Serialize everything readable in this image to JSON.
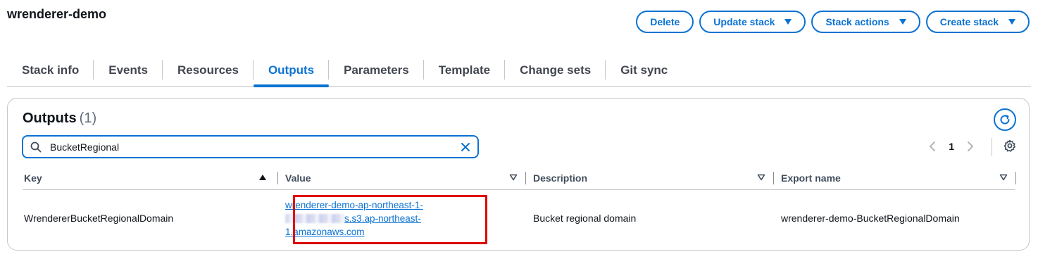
{
  "header": {
    "title": "wrenderer-demo"
  },
  "actions": {
    "delete": "Delete",
    "update_stack": "Update stack",
    "stack_actions": "Stack actions",
    "create_stack": "Create stack"
  },
  "tabs": [
    {
      "label": "Stack info"
    },
    {
      "label": "Events"
    },
    {
      "label": "Resources"
    },
    {
      "label": "Outputs",
      "active": true
    },
    {
      "label": "Parameters"
    },
    {
      "label": "Template"
    },
    {
      "label": "Change sets"
    },
    {
      "label": "Git sync"
    }
  ],
  "outputs": {
    "title": "Outputs",
    "count": "(1)",
    "search": {
      "value": "BucketRegional"
    },
    "pagination": {
      "page": "1"
    },
    "columns": [
      "Key",
      "Value",
      "Description",
      "Export name"
    ],
    "rows": [
      {
        "key": "WrendererBucketRegionalDomain",
        "value_line1": "wrenderer-demo-ap-northeast-1-",
        "value_line2": "s.s3.ap-northeast-",
        "value_line3": "1.amazonaws.com",
        "description": "Bucket regional domain",
        "export_name": "wrenderer-demo-BucketRegionalDomain"
      }
    ]
  },
  "icons": {
    "search": "search-icon",
    "clear": "close-icon",
    "refresh": "refresh-icon",
    "settings": "gear-icon",
    "prev": "chevron-left-icon",
    "next": "chevron-right-icon"
  },
  "colors": {
    "accent": "#0972d3",
    "highlight": "#e00000"
  }
}
